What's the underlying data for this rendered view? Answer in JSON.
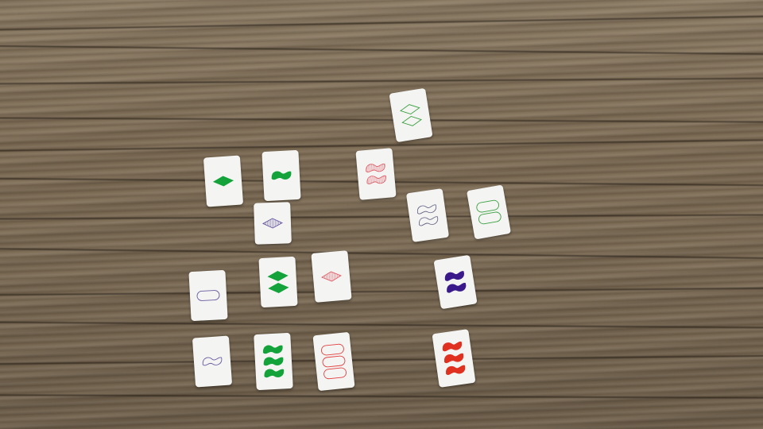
{
  "game": "Set card game",
  "cards": [
    {
      "id": "c01",
      "count": 2,
      "shape": "diamond",
      "fill": "empty",
      "color": "#3aa040"
    },
    {
      "id": "c02",
      "count": 1,
      "shape": "diamond",
      "fill": "solid",
      "color": "#13a33a"
    },
    {
      "id": "c03",
      "count": 1,
      "shape": "squiggle",
      "fill": "solid",
      "color": "#13a33a"
    },
    {
      "id": "c04",
      "count": 2,
      "shape": "squiggle",
      "fill": "striped",
      "color": "#e0606a"
    },
    {
      "id": "c05",
      "count": 2,
      "shape": "squiggle",
      "fill": "empty",
      "color": "#6a6a8a"
    },
    {
      "id": "c06",
      "count": 2,
      "shape": "oval",
      "fill": "empty",
      "color": "#3aa040"
    },
    {
      "id": "c07",
      "count": 1,
      "shape": "diamond",
      "fill": "striped",
      "color": "#6a5aa0"
    },
    {
      "id": "c08",
      "count": 1,
      "shape": "oval",
      "fill": "empty",
      "color": "#6a5aa0"
    },
    {
      "id": "c09",
      "count": 2,
      "shape": "diamond",
      "fill": "solid",
      "color": "#13a33a"
    },
    {
      "id": "c10",
      "count": 1,
      "shape": "diamond",
      "fill": "striped",
      "color": "#e0606a"
    },
    {
      "id": "c11",
      "count": 2,
      "shape": "squiggle",
      "fill": "solid",
      "color": "#3a1a8a"
    },
    {
      "id": "c12",
      "count": 1,
      "shape": "squiggle",
      "fill": "empty",
      "color": "#6a5aa0"
    },
    {
      "id": "c13",
      "count": 3,
      "shape": "squiggle",
      "fill": "solid",
      "color": "#13a33a"
    },
    {
      "id": "c14",
      "count": 3,
      "shape": "oval",
      "fill": "empty",
      "color": "#e04040"
    },
    {
      "id": "c15",
      "count": 3,
      "shape": "squiggle",
      "fill": "solid",
      "color": "#e03020"
    }
  ]
}
